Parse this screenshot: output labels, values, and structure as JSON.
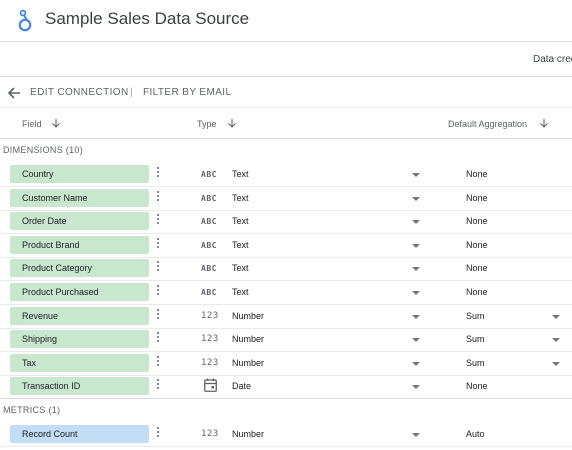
{
  "app": {
    "title": "Sample Sales Data Source",
    "data_credentials_label": "Data cred",
    "logo_color": "#4285f4"
  },
  "nav": {
    "edit_connection": "EDIT CONNECTION",
    "separator": "|",
    "filter_by_email": "FILTER BY EMAIL"
  },
  "columns": {
    "field": "Field",
    "type": "Type",
    "default_aggregation": "Default Aggregation"
  },
  "dimensions": {
    "header": "DIMENSIONS (10)",
    "rows": [
      {
        "field": "Country",
        "type_icon": "ABC",
        "type": "Text",
        "aggregation": "None",
        "agg_dropdown": false
      },
      {
        "field": "Customer Name",
        "type_icon": "ABC",
        "type": "Text",
        "aggregation": "None",
        "agg_dropdown": false
      },
      {
        "field": "Order Date",
        "type_icon": "ABC",
        "type": "Text",
        "aggregation": "None",
        "agg_dropdown": false
      },
      {
        "field": "Product Brand",
        "type_icon": "ABC",
        "type": "Text",
        "aggregation": "None",
        "agg_dropdown": false
      },
      {
        "field": "Product Category",
        "type_icon": "ABC",
        "type": "Text",
        "aggregation": "None",
        "agg_dropdown": false
      },
      {
        "field": "Product Purchased",
        "type_icon": "ABC",
        "type": "Text",
        "aggregation": "None",
        "agg_dropdown": false
      },
      {
        "field": "Revenue",
        "type_icon": "123",
        "type": "Number",
        "aggregation": "Sum",
        "agg_dropdown": true
      },
      {
        "field": "Shipping",
        "type_icon": "123",
        "type": "Number",
        "aggregation": "Sum",
        "agg_dropdown": true
      },
      {
        "field": "Tax",
        "type_icon": "123",
        "type": "Number",
        "aggregation": "Sum",
        "agg_dropdown": true
      },
      {
        "field": "Transaction ID",
        "type_icon": "calendar-icon",
        "type": "Date",
        "aggregation": "None",
        "agg_dropdown": false
      }
    ]
  },
  "metrics": {
    "header": "METRICS (1)",
    "rows": [
      {
        "field": "Record Count",
        "type_icon": "123",
        "type": "Number",
        "aggregation": "Auto",
        "agg_dropdown": false
      }
    ]
  },
  "colors": {
    "dimension_chip": "#c9e7cf",
    "metric_chip": "#c3ddf7"
  }
}
